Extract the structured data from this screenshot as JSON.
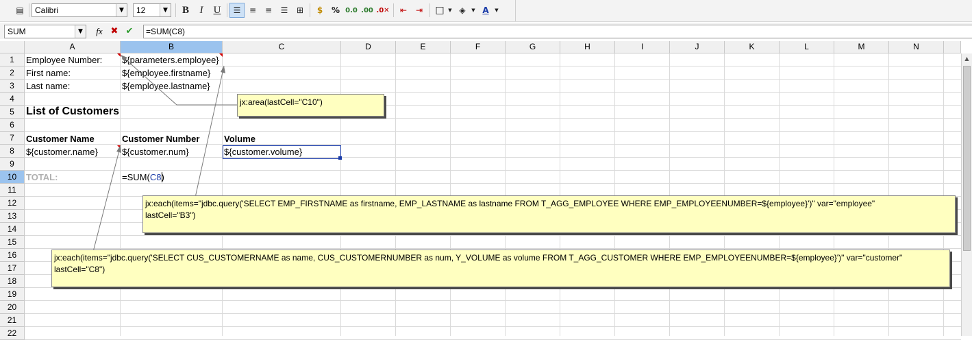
{
  "toolbar": {
    "font_name": "Calibri",
    "font_size": "12",
    "bold_label": "B",
    "italic_label": "I",
    "underline_label": "U",
    "percent_label": "%",
    "icons": [
      "styles-icon",
      "bold-icon",
      "italic-icon",
      "underline-icon",
      "align-left-icon",
      "align-center-icon",
      "align-right-icon",
      "justify-icon",
      "merge-cells-icon",
      "currency-icon",
      "percent-icon",
      "number-format-icon",
      "add-decimal-icon",
      "delete-decimal-icon",
      "decrease-indent-icon",
      "increase-indent-icon",
      "borders-icon",
      "background-color-icon",
      "font-color-icon"
    ]
  },
  "formula_bar": {
    "name_box": "SUM",
    "formula": "=SUM(C8)"
  },
  "columns": [
    "A",
    "B",
    "C",
    "D",
    "E",
    "F",
    "G",
    "H",
    "I",
    "J",
    "K",
    "L",
    "M",
    "N"
  ],
  "selected_column": "B",
  "rows": [
    "1",
    "2",
    "3",
    "4",
    "5",
    "6",
    "7",
    "8",
    "9",
    "10",
    "11",
    "12",
    "13",
    "14",
    "15",
    "16",
    "17",
    "18",
    "19",
    "20",
    "21",
    "22"
  ],
  "selected_row": "10",
  "cells": {
    "a1": "Employee Number:",
    "b1": "${parameters.employee}",
    "a2": "First name:",
    "b2": "${employee.firstname}",
    "a3": "Last name:",
    "b3": "${employee.lastname}",
    "a5": "List of Customers",
    "a7": "Customer Name",
    "b7": "Customer Number",
    "c7": "Volume",
    "a8": "${customer.name}",
    "b8": "${customer.num}",
    "c8": "${customer.volume}",
    "a10": "TOTAL:",
    "b10_prefix": "=SUM(",
    "b10_ref": "C8",
    "b10_suffix": ")"
  },
  "comments": {
    "area": "jx:area(lastCell=\"C10\")",
    "employee": "jx:each(items=\"jdbc.query('SELECT EMP_FIRSTNAME as firstname, EMP_LASTNAME as lastname FROM T_AGG_EMPLOYEE WHERE EMP_EMPLOYEENUMBER=${employee}')\" var=\"employee\"\nlastCell=\"B3\")",
    "customer": "jx:each(items=\"jdbc.query('SELECT CUS_CUSTOMERNAME as name, CUS_CUSTOMERNUMBER as num, Y_VOLUME as volume FROM T_AGG_CUSTOMER WHERE EMP_EMPLOYEENUMBER=${employee}')\" var=\"customer\"\nlastCell=\"C8\")"
  },
  "colors": {
    "selection": "#1a3ba8",
    "header_selected": "#9bc3ee",
    "note_background": "#ffffc0",
    "comment_marker": "#d00000",
    "total_label": "#b0b0b0",
    "reference": "#1a3ba8"
  }
}
